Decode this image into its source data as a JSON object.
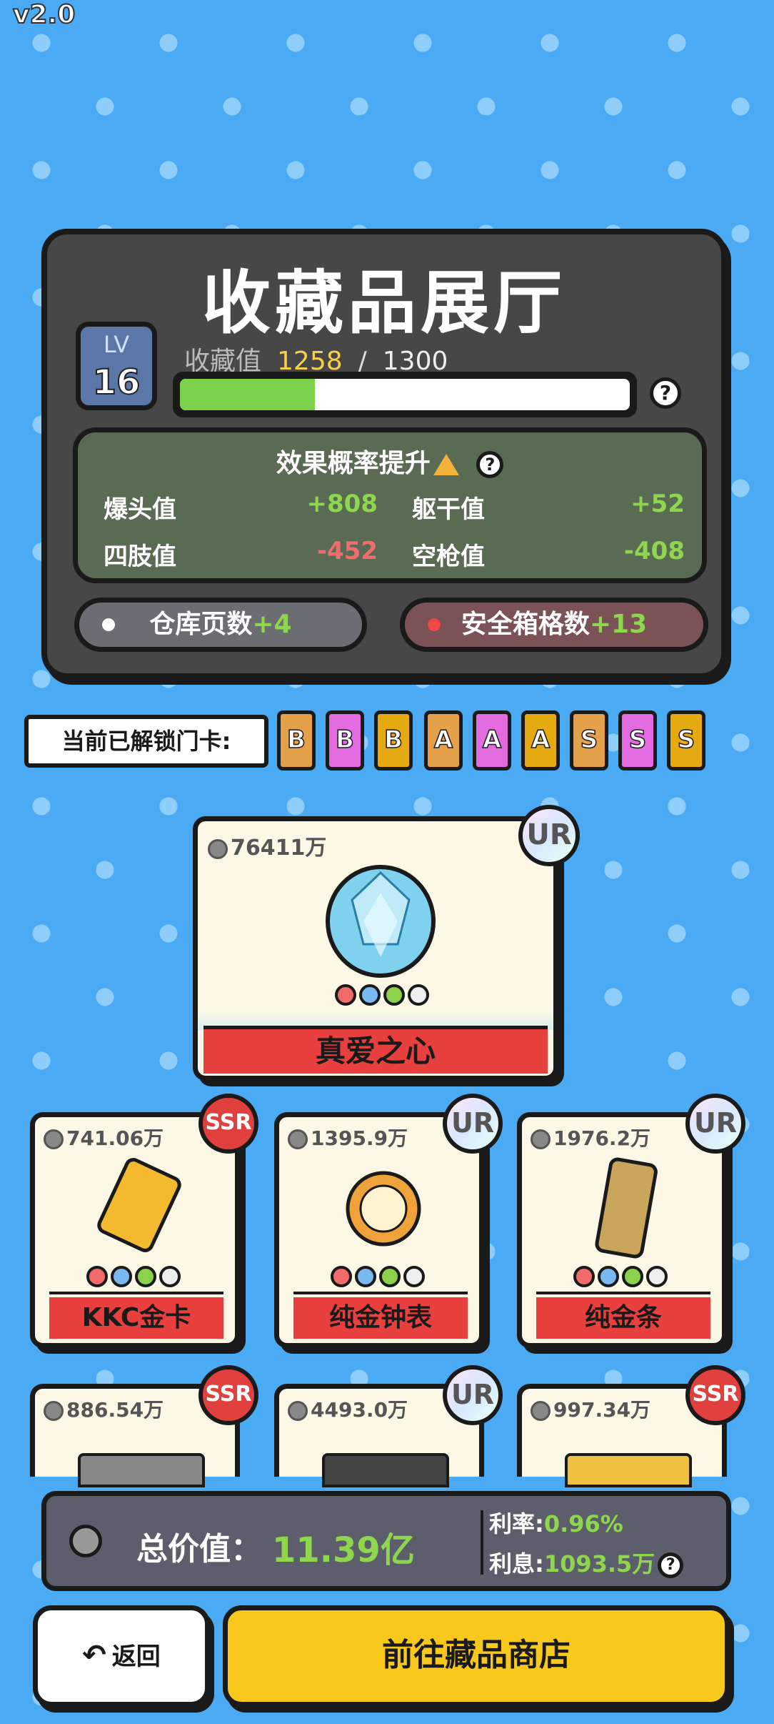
{
  "version": "v2.0",
  "hall": {
    "title": "收藏品展厅",
    "level_label": "LV",
    "level": "16",
    "collect_label": "收藏值",
    "collect_current": "1258",
    "collect_sep": "/",
    "collect_max": "1300",
    "progress_fraction": 0.3,
    "help": "?",
    "effects_title": "效果概率提升",
    "effects": [
      {
        "label": "爆头值",
        "value": "+808",
        "sign": "pos"
      },
      {
        "label": "躯干值",
        "value": "+52",
        "sign": "pos"
      },
      {
        "label": "四肢值",
        "value": "-452",
        "sign": "neg"
      },
      {
        "label": "空枪值",
        "value": "-408",
        "sign": "pos"
      }
    ],
    "warehouse_label": "仓库页数",
    "warehouse_bonus": "+4",
    "safebox_label": "安全箱格数",
    "safebox_bonus": "+13"
  },
  "unlock": {
    "label": "当前已解锁门卡:",
    "cards": [
      {
        "letter": "B",
        "color": "#e5a04a"
      },
      {
        "letter": "B",
        "color": "#e36be0"
      },
      {
        "letter": "B",
        "color": "#e5a912"
      },
      {
        "letter": "A",
        "color": "#e5a04a"
      },
      {
        "letter": "A",
        "color": "#e36be0"
      },
      {
        "letter": "A",
        "color": "#e5a912"
      },
      {
        "letter": "S",
        "color": "#e5a04a"
      },
      {
        "letter": "S",
        "color": "#e36be0"
      },
      {
        "letter": "S",
        "color": "#e5a912"
      }
    ]
  },
  "featured": {
    "price": "76411万",
    "rarity": "UR",
    "name": "真爱之心"
  },
  "items": [
    {
      "price": "741.06万",
      "rarity": "SSR",
      "name": "KKC金卡"
    },
    {
      "price": "1395.9万",
      "rarity": "UR",
      "name": "纯金钟表"
    },
    {
      "price": "1976.2万",
      "rarity": "UR",
      "name": "纯金条"
    },
    {
      "price": "886.54万",
      "rarity": "SSR",
      "name": ""
    },
    {
      "price": "4493.0万",
      "rarity": "UR",
      "name": ""
    },
    {
      "price": "997.34万",
      "rarity": "SSR",
      "name": ""
    }
  ],
  "footer": {
    "total_label": "总价值：",
    "total_value": "11.39亿",
    "rate_label": "利率:",
    "rate_value": "0.96%",
    "interest_label": "利息:",
    "interest_value": "1093.5万"
  },
  "buttons": {
    "back": "返回",
    "shop": "前往藏品商店"
  }
}
